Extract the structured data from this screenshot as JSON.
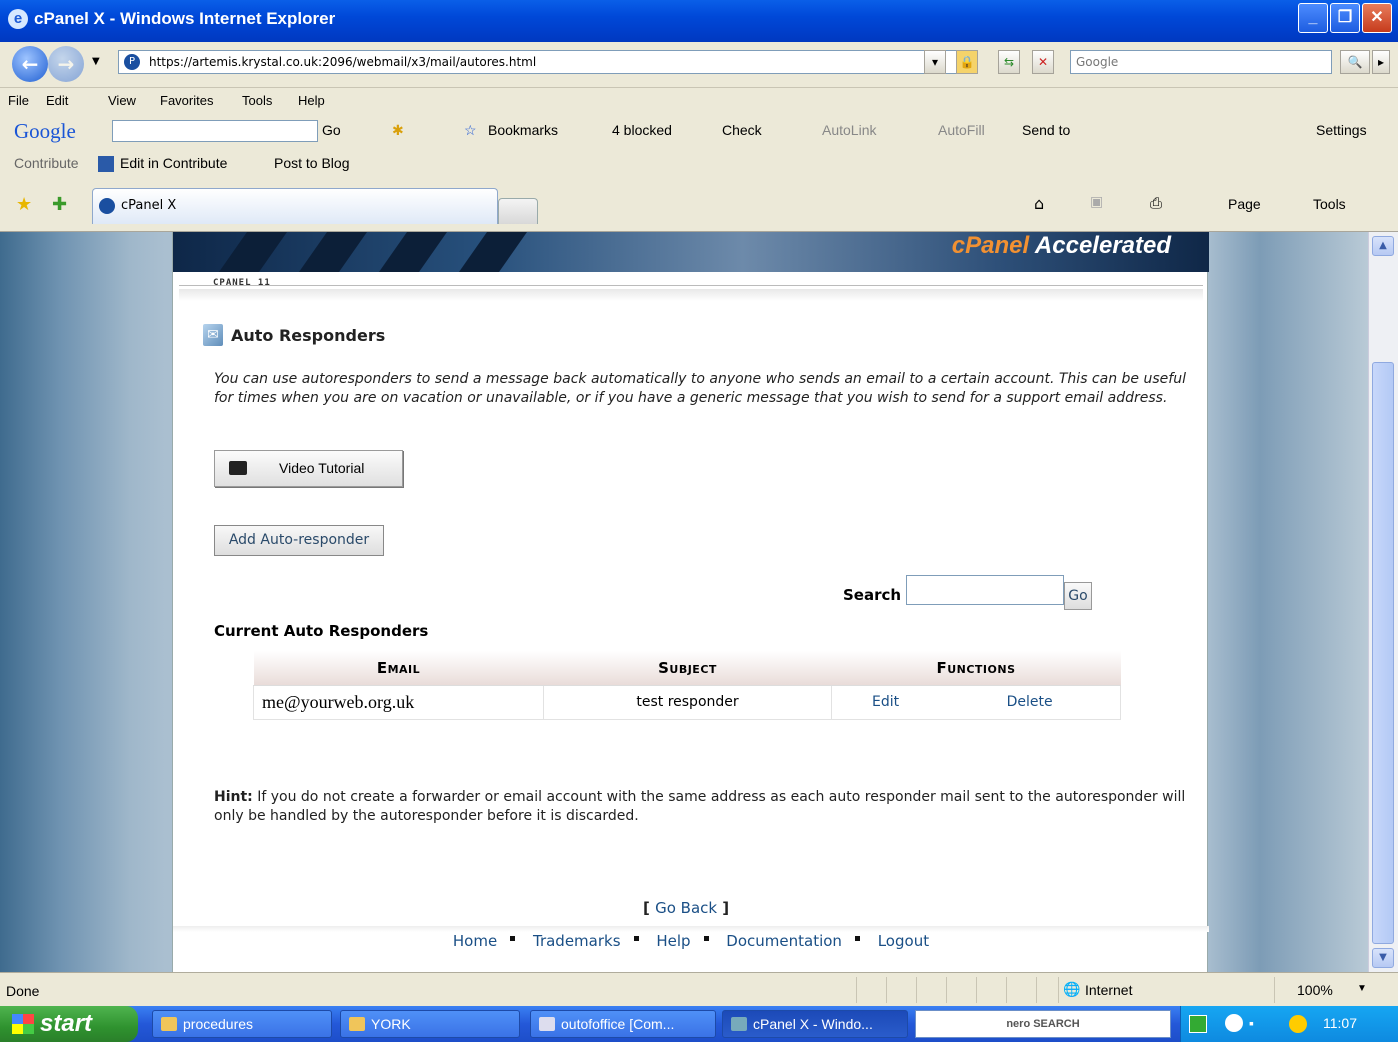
{
  "window": {
    "title": "cPanel X - Windows Internet Explorer"
  },
  "address": {
    "url": "https://artemis.krystal.co.uk:2096/webmail/x3/mail/autores.html",
    "search_placeholder": "Google"
  },
  "menu": [
    "File",
    "Edit",
    "View",
    "Favorites",
    "Tools",
    "Help"
  ],
  "googlebar": {
    "logo": "Google",
    "go": "Go",
    "bookmarks": "Bookmarks",
    "blocked": "4 blocked",
    "check": "Check",
    "autolink": "AutoLink",
    "autofill": "AutoFill",
    "sendto": "Send to",
    "settings": "Settings"
  },
  "contribute": {
    "label": "Contribute",
    "edit": "Edit in Contribute",
    "post": "Post to Blog"
  },
  "tabs": {
    "active": "cPanel X",
    "page": "Page",
    "tools": "Tools"
  },
  "banner": {
    "brand_a": "cPanel",
    "brand_b": "Accelerated",
    "version": "CPANEL 11"
  },
  "page": {
    "title": "Auto Responders",
    "description": "You can use autoresponders to send a message back automatically to anyone who sends an email to a certain account. This can be useful for times when you are on vacation or unavailable, or if you have a generic message that you wish to send for a support email address.",
    "video_label": "Video Tutorial",
    "add_label": "Add Auto-responder",
    "search_label": "Search",
    "go_label": "Go",
    "current_label": "Current Auto Responders",
    "table": {
      "headers": [
        "Email",
        "Subject",
        "Functions"
      ],
      "rows": [
        {
          "email": "me@yourweb.org.uk",
          "subject": "test responder",
          "edit": "Edit",
          "delete": "Delete"
        }
      ]
    },
    "hint_label": "Hint:",
    "hint_text": " If you do not create a forwarder or email account with the same address as each auto responder mail sent to the autoresponder will only be handled by the autoresponder before it is discarded.",
    "go_back": "Go Back",
    "footer": [
      "Home",
      "Trademarks",
      "Help",
      "Documentation",
      "Logout"
    ]
  },
  "status": {
    "text": "Done",
    "zone": "Internet",
    "zoom": "100%"
  },
  "taskbar": {
    "start": "start",
    "items": [
      "procedures",
      "YORK",
      "outofoffice [Com...",
      "cPanel X - Windo..."
    ],
    "nero": "nero SEARCH",
    "clock": "11:07"
  }
}
